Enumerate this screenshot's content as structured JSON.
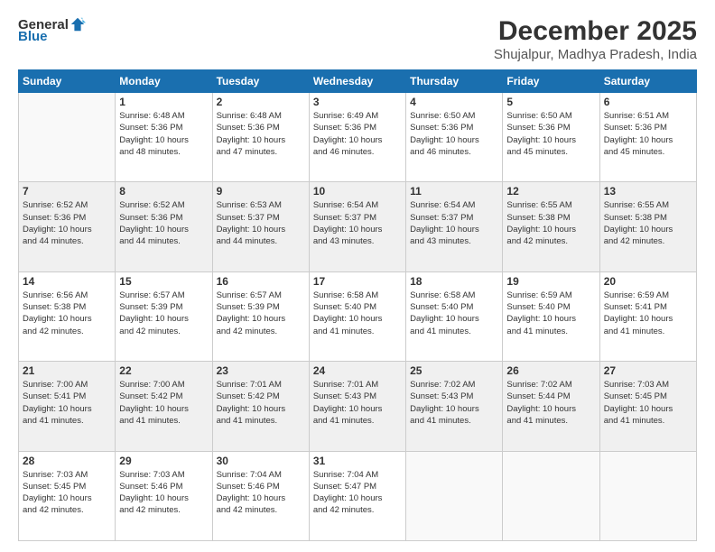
{
  "header": {
    "logo_general": "General",
    "logo_blue": "Blue",
    "month": "December 2025",
    "location": "Shujalpur, Madhya Pradesh, India"
  },
  "weekdays": [
    "Sunday",
    "Monday",
    "Tuesday",
    "Wednesday",
    "Thursday",
    "Friday",
    "Saturday"
  ],
  "weeks": [
    [
      {
        "day": "",
        "info": ""
      },
      {
        "day": "1",
        "info": "Sunrise: 6:48 AM\nSunset: 5:36 PM\nDaylight: 10 hours\nand 48 minutes."
      },
      {
        "day": "2",
        "info": "Sunrise: 6:48 AM\nSunset: 5:36 PM\nDaylight: 10 hours\nand 47 minutes."
      },
      {
        "day": "3",
        "info": "Sunrise: 6:49 AM\nSunset: 5:36 PM\nDaylight: 10 hours\nand 46 minutes."
      },
      {
        "day": "4",
        "info": "Sunrise: 6:50 AM\nSunset: 5:36 PM\nDaylight: 10 hours\nand 46 minutes."
      },
      {
        "day": "5",
        "info": "Sunrise: 6:50 AM\nSunset: 5:36 PM\nDaylight: 10 hours\nand 45 minutes."
      },
      {
        "day": "6",
        "info": "Sunrise: 6:51 AM\nSunset: 5:36 PM\nDaylight: 10 hours\nand 45 minutes."
      }
    ],
    [
      {
        "day": "7",
        "info": "Sunrise: 6:52 AM\nSunset: 5:36 PM\nDaylight: 10 hours\nand 44 minutes."
      },
      {
        "day": "8",
        "info": "Sunrise: 6:52 AM\nSunset: 5:36 PM\nDaylight: 10 hours\nand 44 minutes."
      },
      {
        "day": "9",
        "info": "Sunrise: 6:53 AM\nSunset: 5:37 PM\nDaylight: 10 hours\nand 44 minutes."
      },
      {
        "day": "10",
        "info": "Sunrise: 6:54 AM\nSunset: 5:37 PM\nDaylight: 10 hours\nand 43 minutes."
      },
      {
        "day": "11",
        "info": "Sunrise: 6:54 AM\nSunset: 5:37 PM\nDaylight: 10 hours\nand 43 minutes."
      },
      {
        "day": "12",
        "info": "Sunrise: 6:55 AM\nSunset: 5:38 PM\nDaylight: 10 hours\nand 42 minutes."
      },
      {
        "day": "13",
        "info": "Sunrise: 6:55 AM\nSunset: 5:38 PM\nDaylight: 10 hours\nand 42 minutes."
      }
    ],
    [
      {
        "day": "14",
        "info": "Sunrise: 6:56 AM\nSunset: 5:38 PM\nDaylight: 10 hours\nand 42 minutes."
      },
      {
        "day": "15",
        "info": "Sunrise: 6:57 AM\nSunset: 5:39 PM\nDaylight: 10 hours\nand 42 minutes."
      },
      {
        "day": "16",
        "info": "Sunrise: 6:57 AM\nSunset: 5:39 PM\nDaylight: 10 hours\nand 42 minutes."
      },
      {
        "day": "17",
        "info": "Sunrise: 6:58 AM\nSunset: 5:40 PM\nDaylight: 10 hours\nand 41 minutes."
      },
      {
        "day": "18",
        "info": "Sunrise: 6:58 AM\nSunset: 5:40 PM\nDaylight: 10 hours\nand 41 minutes."
      },
      {
        "day": "19",
        "info": "Sunrise: 6:59 AM\nSunset: 5:40 PM\nDaylight: 10 hours\nand 41 minutes."
      },
      {
        "day": "20",
        "info": "Sunrise: 6:59 AM\nSunset: 5:41 PM\nDaylight: 10 hours\nand 41 minutes."
      }
    ],
    [
      {
        "day": "21",
        "info": "Sunrise: 7:00 AM\nSunset: 5:41 PM\nDaylight: 10 hours\nand 41 minutes."
      },
      {
        "day": "22",
        "info": "Sunrise: 7:00 AM\nSunset: 5:42 PM\nDaylight: 10 hours\nand 41 minutes."
      },
      {
        "day": "23",
        "info": "Sunrise: 7:01 AM\nSunset: 5:42 PM\nDaylight: 10 hours\nand 41 minutes."
      },
      {
        "day": "24",
        "info": "Sunrise: 7:01 AM\nSunset: 5:43 PM\nDaylight: 10 hours\nand 41 minutes."
      },
      {
        "day": "25",
        "info": "Sunrise: 7:02 AM\nSunset: 5:43 PM\nDaylight: 10 hours\nand 41 minutes."
      },
      {
        "day": "26",
        "info": "Sunrise: 7:02 AM\nSunset: 5:44 PM\nDaylight: 10 hours\nand 41 minutes."
      },
      {
        "day": "27",
        "info": "Sunrise: 7:03 AM\nSunset: 5:45 PM\nDaylight: 10 hours\nand 41 minutes."
      }
    ],
    [
      {
        "day": "28",
        "info": "Sunrise: 7:03 AM\nSunset: 5:45 PM\nDaylight: 10 hours\nand 42 minutes."
      },
      {
        "day": "29",
        "info": "Sunrise: 7:03 AM\nSunset: 5:46 PM\nDaylight: 10 hours\nand 42 minutes."
      },
      {
        "day": "30",
        "info": "Sunrise: 7:04 AM\nSunset: 5:46 PM\nDaylight: 10 hours\nand 42 minutes."
      },
      {
        "day": "31",
        "info": "Sunrise: 7:04 AM\nSunset: 5:47 PM\nDaylight: 10 hours\nand 42 minutes."
      },
      {
        "day": "",
        "info": ""
      },
      {
        "day": "",
        "info": ""
      },
      {
        "day": "",
        "info": ""
      }
    ]
  ]
}
